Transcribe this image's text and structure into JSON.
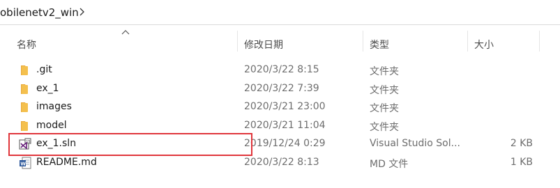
{
  "address": {
    "path_text": "obilenetv2_win"
  },
  "columns": {
    "name": "名称",
    "date": "修改日期",
    "type": "类型",
    "size": "大小"
  },
  "files": [
    {
      "name": ".git",
      "date": "2020/3/22 8:15",
      "type": "文件夹",
      "size": "",
      "icon": "folder-icon"
    },
    {
      "name": "ex_1",
      "date": "2020/3/22 7:39",
      "type": "文件夹",
      "size": "",
      "icon": "folder-icon"
    },
    {
      "name": "images",
      "date": "2020/3/21 23:00",
      "type": "文件夹",
      "size": "",
      "icon": "folder-icon"
    },
    {
      "name": "model",
      "date": "2020/3/21 11:04",
      "type": "文件夹",
      "size": "",
      "icon": "folder-icon"
    },
    {
      "name": "ex_1.sln",
      "date": "2019/12/24 0:29",
      "type": "Visual Studio Sol...",
      "size": "2 KB",
      "icon": "visual-studio-solution-icon"
    },
    {
      "name": "README.md",
      "date": "2020/3/22 8:13",
      "type": "MD 文件",
      "size": "1 KB",
      "icon": "word-document-icon"
    }
  ],
  "colors": {
    "folder": "#f4c04e",
    "highlight": "#e0353b",
    "vs_purple": "#68217a",
    "word_blue": "#2b579a"
  }
}
